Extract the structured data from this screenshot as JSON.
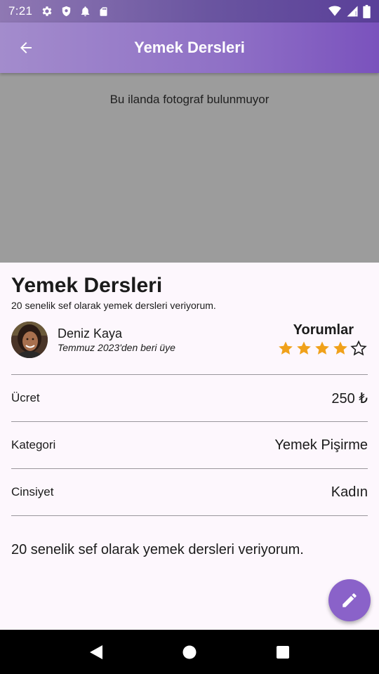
{
  "status_bar": {
    "time": "7:21"
  },
  "app_bar": {
    "title": "Yemek Dersleri"
  },
  "photo": {
    "empty_text": "Bu ilanda fotograf bulunmuyor"
  },
  "listing": {
    "title": "Yemek Dersleri",
    "subtitle": "20 senelik sef olarak yemek dersleri veriyorum.",
    "description": "20 senelik sef olarak yemek dersleri veriyorum."
  },
  "user": {
    "name": "Deniz Kaya",
    "member_since": "Temmuz 2023'den beri üye"
  },
  "reviews": {
    "title": "Yorumlar",
    "rating": 4,
    "max": 5,
    "star_color": "#f0a11a"
  },
  "details": [
    {
      "label": "Ücret",
      "value": "250 ₺"
    },
    {
      "label": "Kategori",
      "value": "Yemek Pişirme"
    },
    {
      "label": "Cinsiyet",
      "value": "Kadın"
    }
  ],
  "icons": {
    "status": [
      "settings-icon",
      "shield-icon",
      "notification-icon",
      "sd-card-icon",
      "wifi-icon",
      "signal-icon",
      "battery-icon"
    ],
    "back": "back-arrow-icon",
    "fab": "edit-icon",
    "nav": [
      "back-triangle-icon",
      "home-circle-icon",
      "recents-square-icon"
    ]
  },
  "colors": {
    "accent": "#8a62c9",
    "app_bar": "#8f70c6",
    "photo_bg": "#9c9c9c"
  }
}
